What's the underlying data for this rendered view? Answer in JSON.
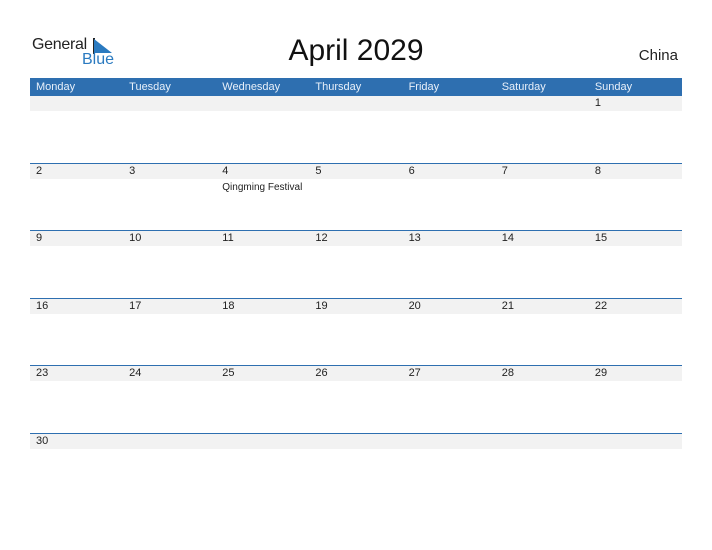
{
  "logo": {
    "general": "General",
    "blue": "Blue"
  },
  "title": "April 2029",
  "country": "China",
  "colors": {
    "header": "#2e6fb0",
    "strip": "#f2f2f2",
    "accent": "#2a7ac0"
  },
  "weekdays": [
    "Monday",
    "Tuesday",
    "Wednesday",
    "Thursday",
    "Friday",
    "Saturday",
    "Sunday"
  ],
  "weeks": [
    {
      "days": [
        "",
        "",
        "",
        "",
        "",
        "",
        "1"
      ],
      "events": [
        "",
        "",
        "",
        "",
        "",
        "",
        ""
      ]
    },
    {
      "days": [
        "2",
        "3",
        "4",
        "5",
        "6",
        "7",
        "8"
      ],
      "events": [
        "",
        "",
        "Qingming Festival",
        "",
        "",
        "",
        ""
      ]
    },
    {
      "days": [
        "9",
        "10",
        "11",
        "12",
        "13",
        "14",
        "15"
      ],
      "events": [
        "",
        "",
        "",
        "",
        "",
        "",
        ""
      ]
    },
    {
      "days": [
        "16",
        "17",
        "18",
        "19",
        "20",
        "21",
        "22"
      ],
      "events": [
        "",
        "",
        "",
        "",
        "",
        "",
        ""
      ]
    },
    {
      "days": [
        "23",
        "24",
        "25",
        "26",
        "27",
        "28",
        "29"
      ],
      "events": [
        "",
        "",
        "",
        "",
        "",
        "",
        ""
      ]
    },
    {
      "days": [
        "30",
        "",
        "",
        "",
        "",
        "",
        ""
      ],
      "events": [
        "",
        "",
        "",
        "",
        "",
        "",
        ""
      ]
    }
  ]
}
